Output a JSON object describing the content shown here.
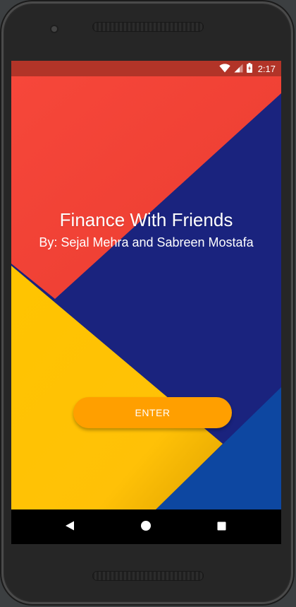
{
  "status_bar": {
    "time": "2:17",
    "icons": [
      "wifi-icon",
      "cell-signal-icon",
      "battery-charging-icon"
    ]
  },
  "main": {
    "title": "Finance With Friends",
    "subtitle": "By: Sejal Mehra and Sabreen Mostafa",
    "enter_label": "ENTER"
  },
  "nav_bar": {
    "icons": [
      "back-icon",
      "home-icon",
      "recents-icon"
    ]
  },
  "colors": {
    "status_bar": "#b23428",
    "wallpaper_red": "#f44336",
    "wallpaper_indigo": "#1a237e",
    "wallpaper_yellow": "#ffc107",
    "wallpaper_blue": "#0d47a1",
    "button_orange": "#ff9f00"
  }
}
